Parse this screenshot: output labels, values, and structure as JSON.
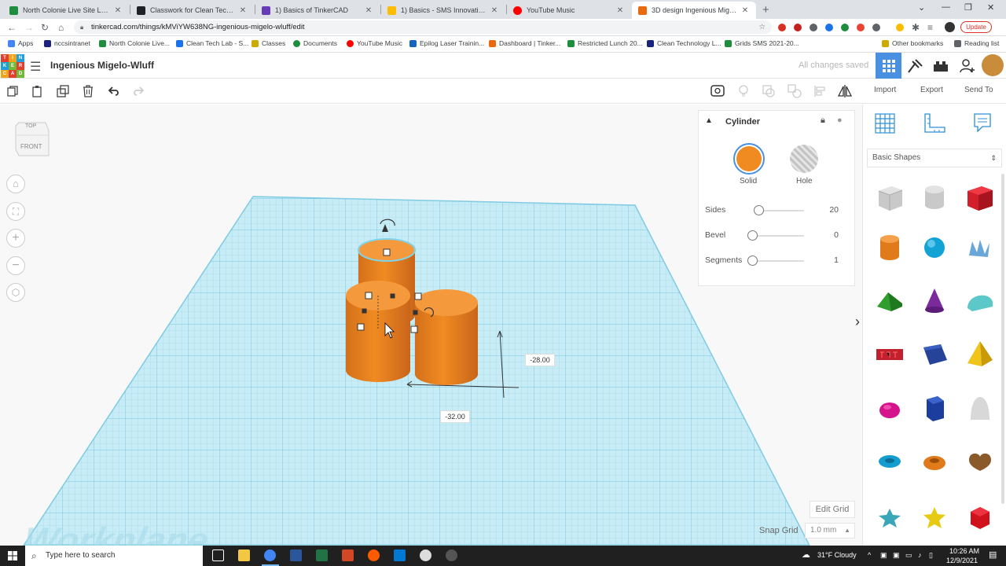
{
  "browser": {
    "tabs": [
      {
        "title": "North Colonie Live Site Login",
        "color": "#1e8e3e"
      },
      {
        "title": "Classwork for Clean Technology L",
        "color": "#202124"
      },
      {
        "title": "1) Basics of TinkerCAD",
        "color": "#673ab7"
      },
      {
        "title": "1) Basics - SMS Innovation Team",
        "color": "#fbbc04"
      },
      {
        "title": "YouTube Music",
        "color": "#ff0000"
      },
      {
        "title": "3D design Ingenious Migelo-Wl",
        "color": "#e9690e",
        "active": true
      }
    ],
    "new_tab": "+",
    "url": "tinkercad.com/things/kMViYW638NG-ingenious-migelo-wluff/edit",
    "update_label": "Update",
    "bookmarks": [
      {
        "label": "Apps",
        "color": "#4285f4"
      },
      {
        "label": "nccsintranet",
        "color": "#1a237e"
      },
      {
        "label": "North Colonie Live...",
        "color": "#1e8e3e"
      },
      {
        "label": "Clean Tech Lab - S...",
        "color": "#1a73e8"
      },
      {
        "label": "Classes",
        "color": "#ccaa00"
      },
      {
        "label": "Documents",
        "color": "#1e8e3e"
      },
      {
        "label": "YouTube Music",
        "color": "#ff0000"
      },
      {
        "label": "Epilog Laser Trainin...",
        "color": "#1565c0"
      },
      {
        "label": "Dashboard | Tinker...",
        "color": "#e9690e"
      },
      {
        "label": "Restricted Lunch 20...",
        "color": "#1e8e3e"
      },
      {
        "label": "Clean Technology L...",
        "color": "#1a237e"
      },
      {
        "label": "Grids SMS 2021-20...",
        "color": "#1e8e3e"
      }
    ],
    "other_bookmarks": "Other bookmarks",
    "reading_list": "Reading list"
  },
  "app": {
    "logo_letters": [
      "TIN",
      "KER",
      "CAD"
    ],
    "project_name": "Ingenious Migelo-Wluff",
    "save_status": "All changes saved",
    "actions": {
      "import": "Import",
      "export": "Export",
      "send_to": "Send To"
    },
    "accent": "#4a90e2"
  },
  "viewcube": {
    "top": "TOP",
    "front": "FRONT"
  },
  "viewport": {
    "dimension_width": "-32.00",
    "dimension_depth": "-28.00",
    "workplane_label": "Workplane",
    "edit_grid": "Edit Grid",
    "snap_grid_label": "Snap Grid",
    "snap_grid_value": "1.0 mm"
  },
  "inspector": {
    "title": "Cylinder",
    "solid_label": "Solid",
    "hole_label": "Hole",
    "solid_color": "#f08b22",
    "params": [
      {
        "label": "Sides",
        "value": "20",
        "level": 0.13
      },
      {
        "label": "Bevel",
        "value": "0",
        "level": 0
      },
      {
        "label": "Segments",
        "value": "1",
        "level": 0
      }
    ]
  },
  "library": {
    "category": "Basic Shapes",
    "shapes": [
      "box-hole",
      "cylinder-hole",
      "box",
      "cylinder",
      "sphere",
      "scribble",
      "roof",
      "cone",
      "round-roof",
      "text",
      "prism",
      "pyramid",
      "half-sphere",
      "polygon",
      "paraboloid",
      "torus",
      "tube",
      "heart",
      "star",
      "star-yellow",
      "icosahedron"
    ]
  },
  "taskbar": {
    "search_placeholder": "Type here to search",
    "weather": "31°F  Cloudy",
    "time": "10:26 AM",
    "date": "12/9/2021"
  }
}
